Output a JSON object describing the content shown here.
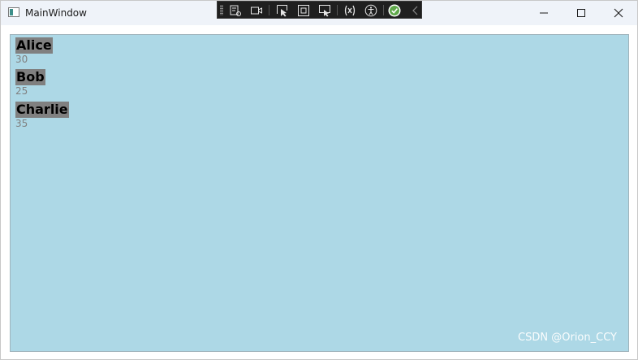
{
  "window": {
    "title": "MainWindow"
  },
  "people": [
    {
      "name": "Alice",
      "age": "30"
    },
    {
      "name": "Bob",
      "age": "25"
    },
    {
      "name": "Charlie",
      "age": "35"
    }
  ],
  "devtools": {
    "icons": [
      "live-visual-tree-icon",
      "record-icon",
      "select-element-icon",
      "display-layout-adorners-icon",
      "track-focus-icon",
      "binding-failures-icon",
      "accessibility-icon",
      "check-icon",
      "collapse-icon"
    ]
  },
  "watermark": "CSDN @Orion_CCY",
  "colors": {
    "background": "#add8e6",
    "name_highlight": "#808080",
    "age_text": "#808080"
  }
}
